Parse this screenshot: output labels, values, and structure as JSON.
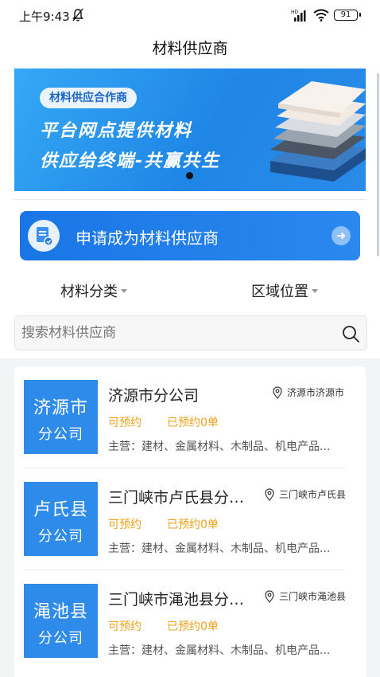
{
  "status_bar": {
    "time": "上午9:43",
    "battery": "91"
  },
  "header": {
    "title": "材料供应商"
  },
  "banner": {
    "tag": "材料供应合作商",
    "line1": "平台网点提供材料",
    "line2": "供应给终端-共赢共生"
  },
  "apply_button": {
    "label": "申请成为材料供应商",
    "icon": "document-icon"
  },
  "filters": {
    "category": "材料分类",
    "region": "区域位置"
  },
  "search": {
    "placeholder": "搜索材料供应商",
    "value": ""
  },
  "suppliers": [
    {
      "logo_line1": "济源市",
      "logo_line2": "分公司",
      "name": "济源市分公司",
      "location": "济源市济源市",
      "status": "可预约",
      "booked": "已预约0单",
      "main": "主营：建材、金属材料、木制品、机电产品..."
    },
    {
      "logo_line1": "卢氏县",
      "logo_line2": "分公司",
      "name": "三门峡市卢氏县分公司",
      "location": "三门峡市卢氏县",
      "status": "可预约",
      "booked": "已预约0单",
      "main": "主营：建材、金属材料、木制品、机电产品..."
    },
    {
      "logo_line1": "渑池县",
      "logo_line2": "分公司",
      "name": "三门峡市渑池县分公司",
      "location": "三门峡市渑池县",
      "status": "可预约",
      "booked": "已预约0单",
      "main": "主营：建材、金属材料、木制品、机电产品..."
    }
  ],
  "colors": {
    "primary": "#2f8bea",
    "accent": "#f0a21b"
  }
}
